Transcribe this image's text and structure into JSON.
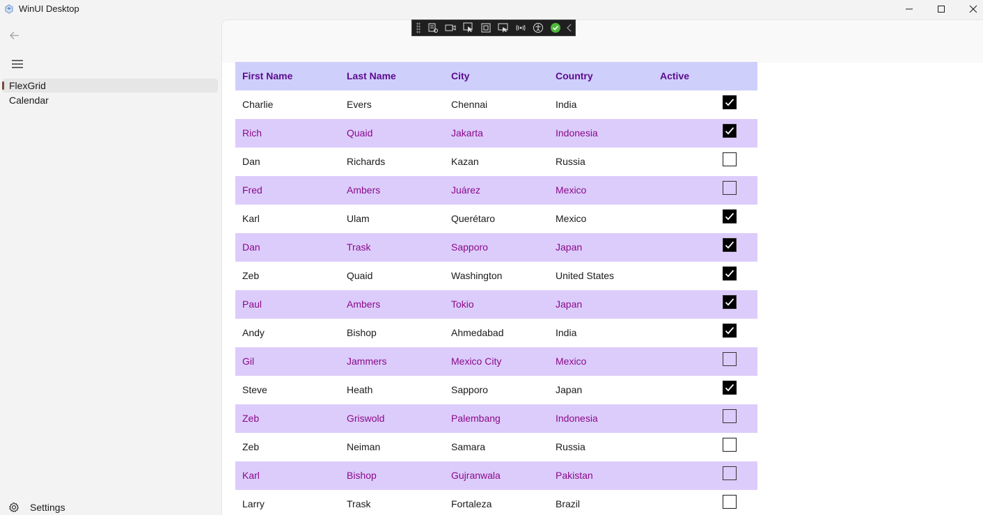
{
  "window": {
    "title": "WinUI Desktop",
    "controls": [
      "minimize",
      "maximize",
      "close"
    ]
  },
  "nav": {
    "items": [
      {
        "label": "FlexGrid",
        "selected": true
      },
      {
        "label": "Calendar",
        "selected": false
      }
    ],
    "settings_label": "Settings"
  },
  "debug_toolbar": {
    "icons": [
      "live-visual-tree-icon",
      "record-icon",
      "select-element-icon",
      "display-layout-adorners-icon",
      "track-focus-icon",
      "hot-reload-icon",
      "accessibility-icon",
      "status-ok-icon",
      "collapse-chevron-icon"
    ]
  },
  "grid": {
    "columns": [
      "First Name",
      "Last Name",
      "City",
      "Country",
      "Active"
    ],
    "rows": [
      {
        "first": "Charlie",
        "last": "Evers",
        "city": "Chennai",
        "country": "India",
        "active": true
      },
      {
        "first": "Rich",
        "last": "Quaid",
        "city": "Jakarta",
        "country": "Indonesia",
        "active": true
      },
      {
        "first": "Dan",
        "last": "Richards",
        "city": "Kazan",
        "country": "Russia",
        "active": false
      },
      {
        "first": "Fred",
        "last": "Ambers",
        "city": "Juárez",
        "country": "Mexico",
        "active": false
      },
      {
        "first": "Karl",
        "last": "Ulam",
        "city": "Querétaro",
        "country": "Mexico",
        "active": true
      },
      {
        "first": "Dan",
        "last": "Trask",
        "city": "Sapporo",
        "country": "Japan",
        "active": true
      },
      {
        "first": "Zeb",
        "last": "Quaid",
        "city": "Washington",
        "country": "United States",
        "active": true
      },
      {
        "first": "Paul",
        "last": "Ambers",
        "city": "Tokio",
        "country": "Japan",
        "active": true
      },
      {
        "first": "Andy",
        "last": "Bishop",
        "city": "Ahmedabad",
        "country": "India",
        "active": true
      },
      {
        "first": "Gil",
        "last": "Jammers",
        "city": "Mexico City",
        "country": "Mexico",
        "active": false
      },
      {
        "first": "Steve",
        "last": "Heath",
        "city": "Sapporo",
        "country": "Japan",
        "active": true
      },
      {
        "first": "Zeb",
        "last": "Griswold",
        "city": "Palembang",
        "country": "Indonesia",
        "active": false
      },
      {
        "first": "Zeb",
        "last": "Neiman",
        "city": "Samara",
        "country": "Russia",
        "active": false
      },
      {
        "first": "Karl",
        "last": "Bishop",
        "city": "Gujranwala",
        "country": "Pakistan",
        "active": false
      },
      {
        "first": "Larry",
        "last": "Trask",
        "city": "Fortaleza",
        "country": "Brazil",
        "active": false
      }
    ]
  },
  "colors": {
    "header_bg": "#cfcffb",
    "header_text": "#5b0a8e",
    "alt_row_bg": "#dcccfb",
    "alt_row_text": "#8a0a8a",
    "nav_selected_accent": "#7a4a3a"
  }
}
